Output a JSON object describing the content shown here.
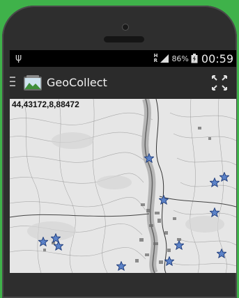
{
  "status_bar": {
    "network_top": "H",
    "network_bottom": "R",
    "battery": "86%",
    "time": "00:59"
  },
  "action_bar": {
    "title": "GeoCollect"
  },
  "map": {
    "coordinates": "44,43172,8,88472",
    "marker_count": 12,
    "colors": {
      "marker_fill": "#5b82c8",
      "marker_stroke": "#1d3a78"
    }
  }
}
